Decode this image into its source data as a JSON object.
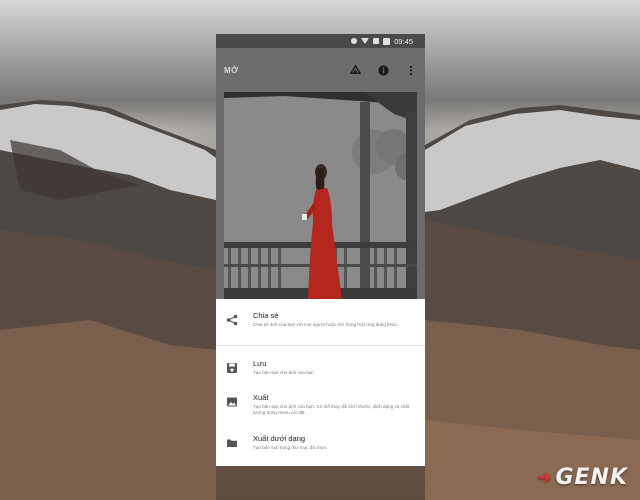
{
  "status_bar": {
    "time": "09:45"
  },
  "app_bar": {
    "title": "MỞ",
    "icons": [
      "drive-icon",
      "info-icon",
      "more-vert-icon"
    ]
  },
  "share_sheet": {
    "items": [
      {
        "icon": "share-icon",
        "title": "Chia sẻ",
        "description": "Chia sẻ ảnh của bạn với mọi người hoặc mở trong một ứng dụng khác."
      },
      {
        "icon": "save-icon",
        "title": "Lưu",
        "description": "Tạo bản sao cho ảnh của bạn"
      },
      {
        "icon": "image-icon",
        "title": "Xuất",
        "description": "Tạo bản sao cho ảnh của bạn. Có thể thay đổi kích thước, định dạng và chất lượng trong menu cài đặt."
      },
      {
        "icon": "folder-icon",
        "title": "Xuất dưới dạng",
        "description": "Tạo bản sao trong thư mục đã chọn."
      }
    ]
  },
  "watermark": {
    "text": "GENK"
  },
  "colors": {
    "status_bar": "#4a4a4a",
    "app_bar": "#6d6d6d",
    "dress_red": "#b5261e",
    "sheet_bg": "#ffffff"
  }
}
